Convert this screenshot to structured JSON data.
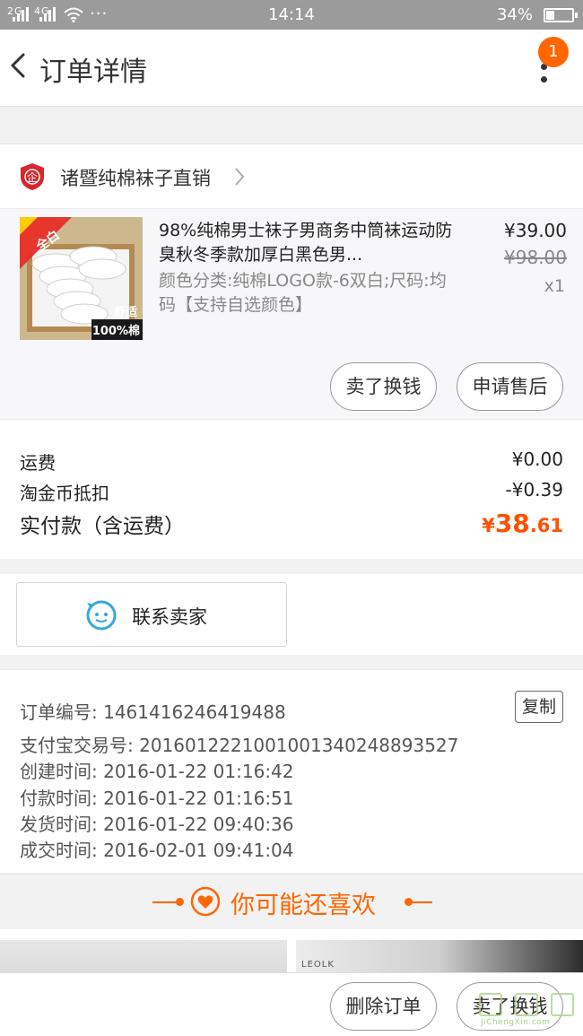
{
  "status_bar": {
    "network1": "2G",
    "network2": "4G",
    "more": "···",
    "time": "14:14",
    "battery": "34%"
  },
  "header": {
    "title": "订单详情",
    "badge_count": "1"
  },
  "shop": {
    "logo_text": "企",
    "name": "诸暨纯棉袜子直销"
  },
  "item": {
    "title": "98%纯棉男士袜子男商务中筒袜运动防臭秋冬季款加厚白黑色男...",
    "sku": "颜色分类:纯棉LOGO款-6双白;尺码:均码【支持自选颜色】",
    "price": "¥39.00",
    "original_price": "¥98.00",
    "quantity": "x1",
    "thumb_tag": "全白",
    "thumb_label1": "舒适",
    "thumb_label2": "100%棉",
    "sell_button": "卖了换钱",
    "aftersale_button": "申请售后"
  },
  "fees": {
    "shipping_label": "运费",
    "shipping_value": "¥0.00",
    "coin_label": "淘金币抵扣",
    "coin_value": "-¥0.39",
    "total_label": "实付款（含运费）",
    "total_currency": "¥",
    "total_integer": "38",
    "total_decimal": ".61"
  },
  "contact": {
    "label": "联系卖家"
  },
  "order_info": {
    "order_no": "订单编号: 1461416246419488",
    "copy_button": "复制",
    "alipay_no": "支付宝交易号: 2016012221001001340248893527",
    "created": "创建时间: 2016-01-22 01:16:42",
    "paid": "付款时间: 2016-01-22 01:16:51",
    "shipped": "发货时间: 2016-01-22 09:40:36",
    "completed": "成交时间: 2016-02-01 09:41:04"
  },
  "recommend": {
    "label": "你可能还喜欢",
    "photo2_text": "LEOLK"
  },
  "bottom_bar": {
    "delete_button": "删除订单",
    "sell_button": "卖了换钱",
    "watermark": "JiChengXin.com"
  },
  "colors": {
    "accent": "#ff6600",
    "price_red": "#ff5000",
    "status_bar": "#9b9b9b"
  }
}
